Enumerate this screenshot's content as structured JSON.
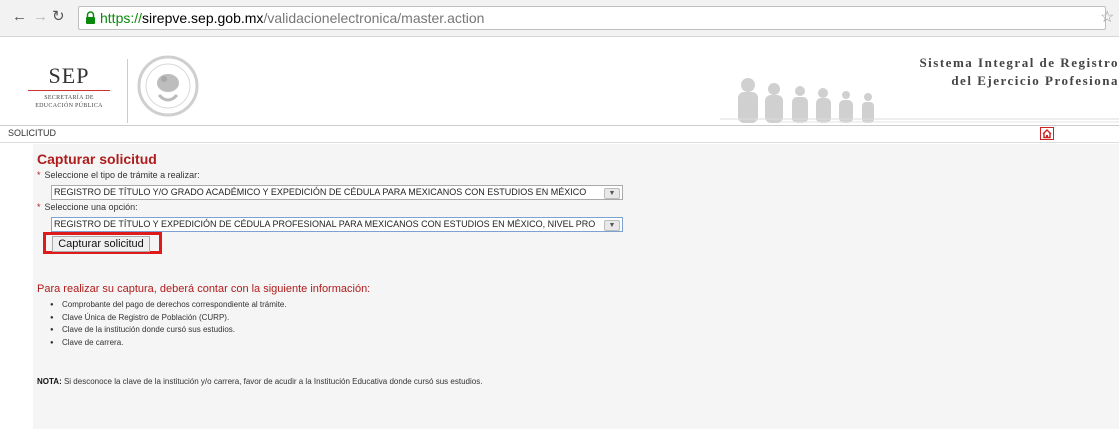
{
  "browser": {
    "url_protocol": "https://",
    "url_host": "sirepve.sep.gob.mx",
    "url_path": "/validacionelectronica/master.action",
    "icons": {
      "back": "arrow-left-icon",
      "forward": "arrow-right-icon",
      "reload": "reload-icon",
      "secure": "lock-icon",
      "bookmark": "star-icon"
    }
  },
  "header": {
    "logo_word": "SEP",
    "logo_sub_line1": "SECRETARÍA DE",
    "logo_sub_line2": "EDUCACIÓN PÚBLICA",
    "site_title_line1": "Sistema Integral de Registro",
    "site_title_line2": "del Ejercicio Profesiona"
  },
  "breadcrumb": {
    "label": "SOLICITUD",
    "home_icon": "home-icon"
  },
  "form": {
    "title": "Capturar solicitud",
    "tramite_label": "Seleccione el tipo de trámite a realizar:",
    "tramite_value": "REGISTRO DE TÍTULO Y/O GRADO ACADÉMICO Y EXPEDICIÓN DE CÉDULA PARA MEXICANOS CON ESTUDIOS EN MÉXICO",
    "opcion_label": "Seleccione una opción:",
    "opcion_value": "REGISTRO DE TÍTULO Y EXPEDICIÓN DE CÉDULA PROFESIONAL PARA MEXICANOS CON ESTUDIOS EN MÉXICO, NIVEL PRO",
    "required_mark": "*",
    "submit_label": "Capturar solicitud"
  },
  "info": {
    "title": "Para realizar su captura, deberá contar con la siguiente información:",
    "items": [
      "Comprobante del pago de derechos correspondiente al trámite.",
      "Clave Única de Registro de Población (CURP).",
      "Clave de la institución donde cursó sus estudios.",
      "Clave de carrera."
    ],
    "note_label": "NOTA:",
    "note_text": " Si desconoce la clave de la institución y/o carrera, favor de acudir a la Institución Educativa donde cursó sus estudios."
  },
  "colors": {
    "accent_red": "#b01c1c",
    "highlight_red": "#e01a1a",
    "url_green": "#0a8a0a"
  }
}
